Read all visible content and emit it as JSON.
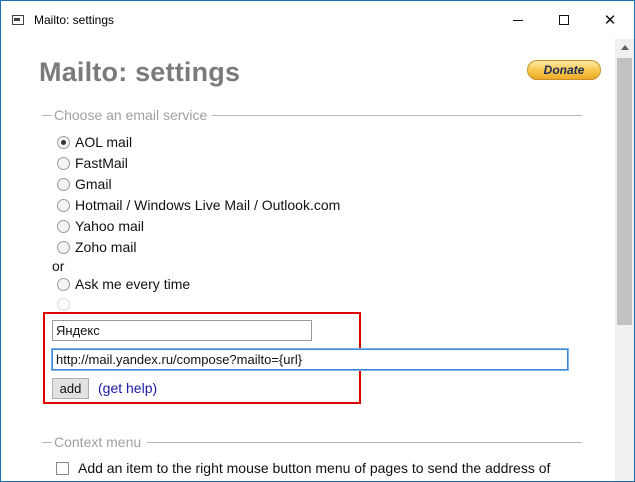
{
  "window": {
    "title": "Mailto: settings"
  },
  "page": {
    "title": "Mailto: settings",
    "donate_label": "Donate"
  },
  "email_service": {
    "legend": "Choose an email service",
    "options": [
      {
        "label": "AOL mail",
        "checked": true
      },
      {
        "label": "FastMail",
        "checked": false
      },
      {
        "label": "Gmail",
        "checked": false
      },
      {
        "label": "Hotmail / Windows Live Mail / Outlook.com",
        "checked": false
      },
      {
        "label": "Yahoo mail",
        "checked": false
      },
      {
        "label": "Zoho mail",
        "checked": false
      }
    ],
    "or_label": "or",
    "ask_label": "Ask me every time"
  },
  "custom": {
    "name_value": "Яндекс",
    "url_value": "http://mail.yandex.ru/compose?mailto={url}",
    "add_label": "add",
    "help_open": "(",
    "help_link": "get help",
    "help_close": ")"
  },
  "context_menu": {
    "legend": "Context menu",
    "checkbox_label": "Add an item to the right mouse button menu of pages to send the address of"
  }
}
